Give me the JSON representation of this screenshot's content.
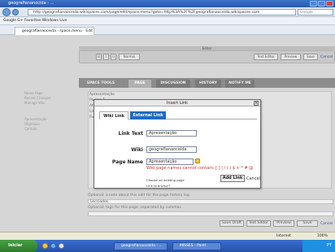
{
  "browser": {
    "title": "geografiananocida - ...",
    "url": "http://geografianaoceida.wikispaces.com/page/edit/space.menu?goto=http%3A%2F%2Fgeografianaoceida.wikispaces.com",
    "search_placeholder": "Google",
    "tab_label": "geografianaoceida - space.menu - Edit",
    "toolbar_text": "Google G+   Favorites   Windows Live"
  },
  "editor": {
    "header": "Editor",
    "toolbar_buttons": [
      "B",
      "I",
      "U",
      "Normal"
    ],
    "text_editor_label": "Text Editor",
    "preview_label": "Preview",
    "save_label": "Save",
    "cancel_label": "Cancel"
  },
  "wiki_nav": {
    "tabs": [
      "SPACE TOOLS",
      "PAGE",
      "DISCUSSION",
      "HISTORY",
      "NOTIFY ME"
    ]
  },
  "sidebar": {
    "items": [
      "Home Page",
      "Recent Changes",
      "Manage Wiki",
      "Apresentação",
      "Objetivos",
      "Contato"
    ]
  },
  "content": {
    "lines": [
      "Apresentação",
      "Pagina 1",
      "Atividades",
      "Links úteis",
      "Fale conosco"
    ],
    "edit_note_label": "Optional: a note about this edit for the page history log",
    "edit_note_value": "Lecciados",
    "tags_label": "Optional: tags for this page, separated by commas",
    "bottom_buttons": [
      "Save Draft",
      "Text Editor",
      "Preview",
      "Save"
    ],
    "bottom_cancel": "Cancel"
  },
  "dialog": {
    "title": "Insert Link",
    "close": "×",
    "tab_wiki": "Wiki Link",
    "tab_external": "External Link",
    "link_text_label": "Link Text",
    "link_text_value": "Apresentação",
    "wiki_label": "Wiki",
    "wiki_value": "geografianaoceida",
    "page_name_label": "Page Name",
    "page_name_value": "Apresentação",
    "warning": "Wiki page names cannot contain: [ ] | / ( ) $ + * # @",
    "choose_existing": "Choose an existing page",
    "link_anchor": "Link to anchor?",
    "add_link_label": "Add Link",
    "cancel_label": "Cancel"
  },
  "status": {
    "zone": "Internet",
    "zoom": "100%"
  },
  "taskbar": {
    "start": "Iniciar",
    "tasks": [
      "geografianaoceida - ...",
      "MISSES - Paint"
    ],
    "clock": "PT"
  }
}
